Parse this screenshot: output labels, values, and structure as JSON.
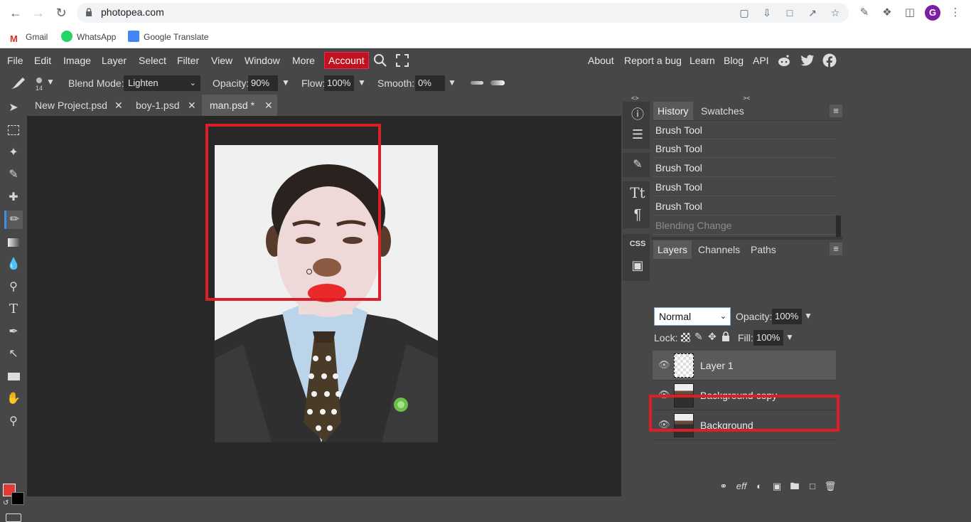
{
  "browser": {
    "url": "photopea.com",
    "profile_initial": "G",
    "bookmarks": [
      "Gmail",
      "WhatsApp",
      "Google Translate"
    ]
  },
  "menu": {
    "items": [
      "File",
      "Edit",
      "Image",
      "Layer",
      "Select",
      "Filter",
      "View",
      "Window",
      "More"
    ],
    "account": "Account",
    "right_links": [
      "About",
      "Report a bug",
      "Learn",
      "Blog",
      "API"
    ]
  },
  "options": {
    "brush_size": "14",
    "blend_label": "Blend Mode:",
    "blend_value": "Lighten",
    "opacity_label": "Opacity:",
    "opacity_value": "90%",
    "flow_label": "Flow:",
    "flow_value": "100%",
    "smooth_label": "Smooth:",
    "smooth_value": "0%"
  },
  "tabs": [
    {
      "label": "New Project.psd"
    },
    {
      "label": "boy-1.psd"
    },
    {
      "label": "man.psd *"
    }
  ],
  "history_panel": {
    "tabs": [
      "History",
      "Swatches"
    ],
    "items": [
      "Brush Tool",
      "Brush Tool",
      "Brush Tool",
      "Brush Tool",
      "Brush Tool",
      "Blending Change"
    ]
  },
  "layers_panel": {
    "tabs": [
      "Layers",
      "Channels",
      "Paths"
    ],
    "blend_mode": "Normal",
    "opacity_label": "Opacity:",
    "opacity_value": "100%",
    "lock_label": "Lock:",
    "fill_label": "Fill:",
    "fill_value": "100%",
    "layers": [
      "Layer 1",
      "Background copy",
      "Background"
    ]
  },
  "side_strip": {
    "css_label": "CSS"
  },
  "colors": {
    "foreground": "#e53935",
    "background": "#000000",
    "annotation": "#dc1f26"
  }
}
